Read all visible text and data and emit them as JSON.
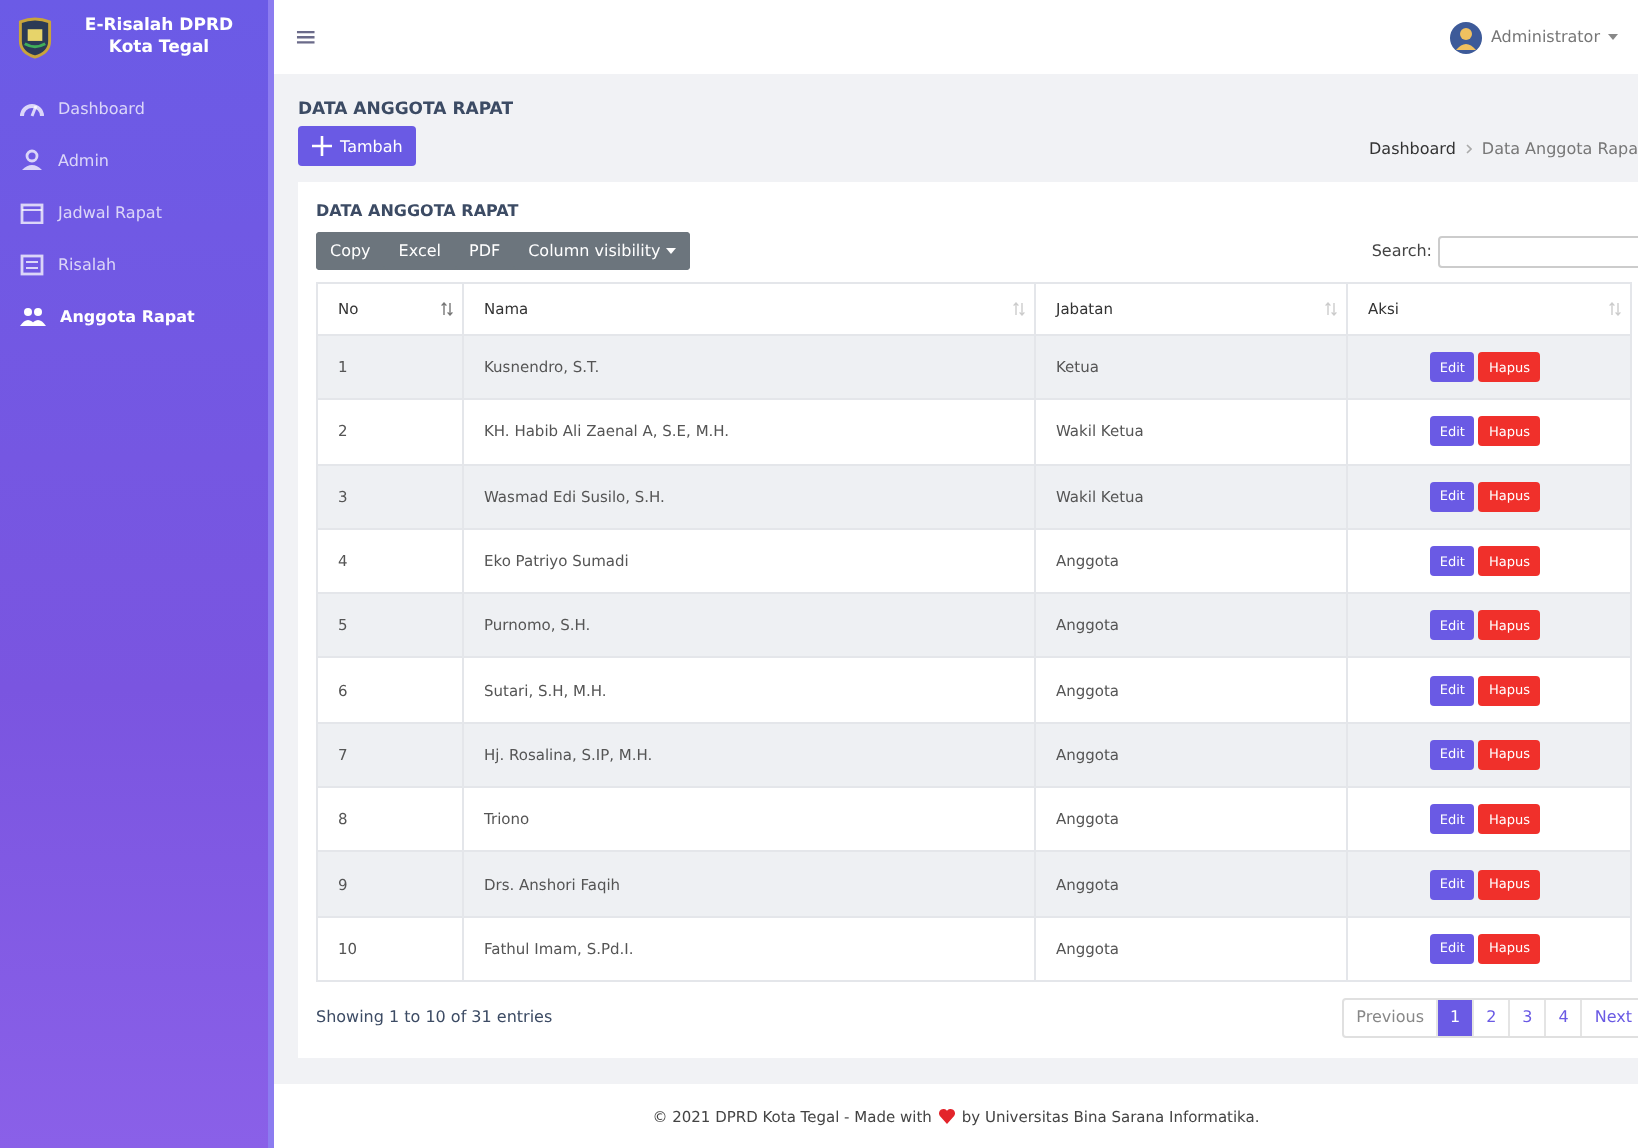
{
  "brand": {
    "title": "E-Risalah DPRD Kota Tegal"
  },
  "topbar": {
    "menu_icon": "≡",
    "user": "Administrator"
  },
  "sidebar": {
    "items": [
      {
        "label": "Dashboard",
        "selected": false
      },
      {
        "label": "Admin",
        "selected": false
      },
      {
        "label": "Jadwal Rapat",
        "selected": false
      },
      {
        "label": "Risalah",
        "selected": false
      },
      {
        "label": "Anggota Rapat",
        "selected": true
      }
    ]
  },
  "page": {
    "title": "DATA ANGGOTA RAPAT",
    "add_button": "Tambah",
    "breadcrumb": [
      "Dashboard",
      "Data Anggota Rapa"
    ]
  },
  "card": {
    "title": "DATA ANGGOTA RAPAT",
    "export_buttons": [
      "Copy",
      "Excel",
      "PDF",
      "Column visibility"
    ],
    "search_label": "Search:"
  },
  "table": {
    "columns": [
      "No",
      "Nama",
      "Jabatan",
      "Aksi"
    ],
    "rows": [
      {
        "no": "1",
        "nama": "Kusnendro, S.T.",
        "jabatan": "Ketua",
        "edit": "Edit",
        "delete": "Hapus"
      },
      {
        "no": "2",
        "nama": "KH. Habib Ali Zaenal A, S.E, M.H.",
        "jabatan": "Wakil Ketua",
        "edit": "Edit",
        "delete": "Hapus"
      },
      {
        "no": "3",
        "nama": "Wasmad Edi Susilo, S.H.",
        "jabatan": "Wakil Ketua",
        "edit": "Edit",
        "delete": "Hapus"
      },
      {
        "no": "4",
        "nama": "Eko Patriyo Sumadi",
        "jabatan": "Anggota",
        "edit": "Edit",
        "delete": "Hapus"
      },
      {
        "no": "5",
        "nama": "Purnomo, S.H.",
        "jabatan": "Anggota",
        "edit": "Edit",
        "delete": "Hapus"
      },
      {
        "no": "6",
        "nama": "Sutari, S.H, M.H.",
        "jabatan": "Anggota",
        "edit": "Edit",
        "delete": "Hapus"
      },
      {
        "no": "7",
        "nama": "Hj. Rosalina, S.IP, M.H.",
        "jabatan": "Anggota",
        "edit": "Edit",
        "delete": "Hapus"
      },
      {
        "no": "8",
        "nama": "Triono",
        "jabatan": "Anggota",
        "edit": "Edit",
        "delete": "Hapus"
      },
      {
        "no": "9",
        "nama": "Drs. Anshori Faqih",
        "jabatan": "Anggota",
        "edit": "Edit",
        "delete": "Hapus"
      },
      {
        "no": "10",
        "nama": "Fathul Imam, S.Pd.I.",
        "jabatan": "Anggota",
        "edit": "Edit",
        "delete": "Hapus"
      }
    ]
  },
  "info": "Showing 1 to 10 of 31 entries",
  "pagination": {
    "previous": "Previous",
    "next": "Next",
    "pages": [
      {
        "label": "1",
        "selected": true
      },
      {
        "label": "2",
        "selected": false
      },
      {
        "label": "3",
        "selected": false
      },
      {
        "label": "4",
        "selected": false
      }
    ]
  },
  "footer": {
    "before": "© 2021 DPRD Kota Tegal - Made with",
    "after": "by Universitas Bina Sarana Informatika."
  }
}
